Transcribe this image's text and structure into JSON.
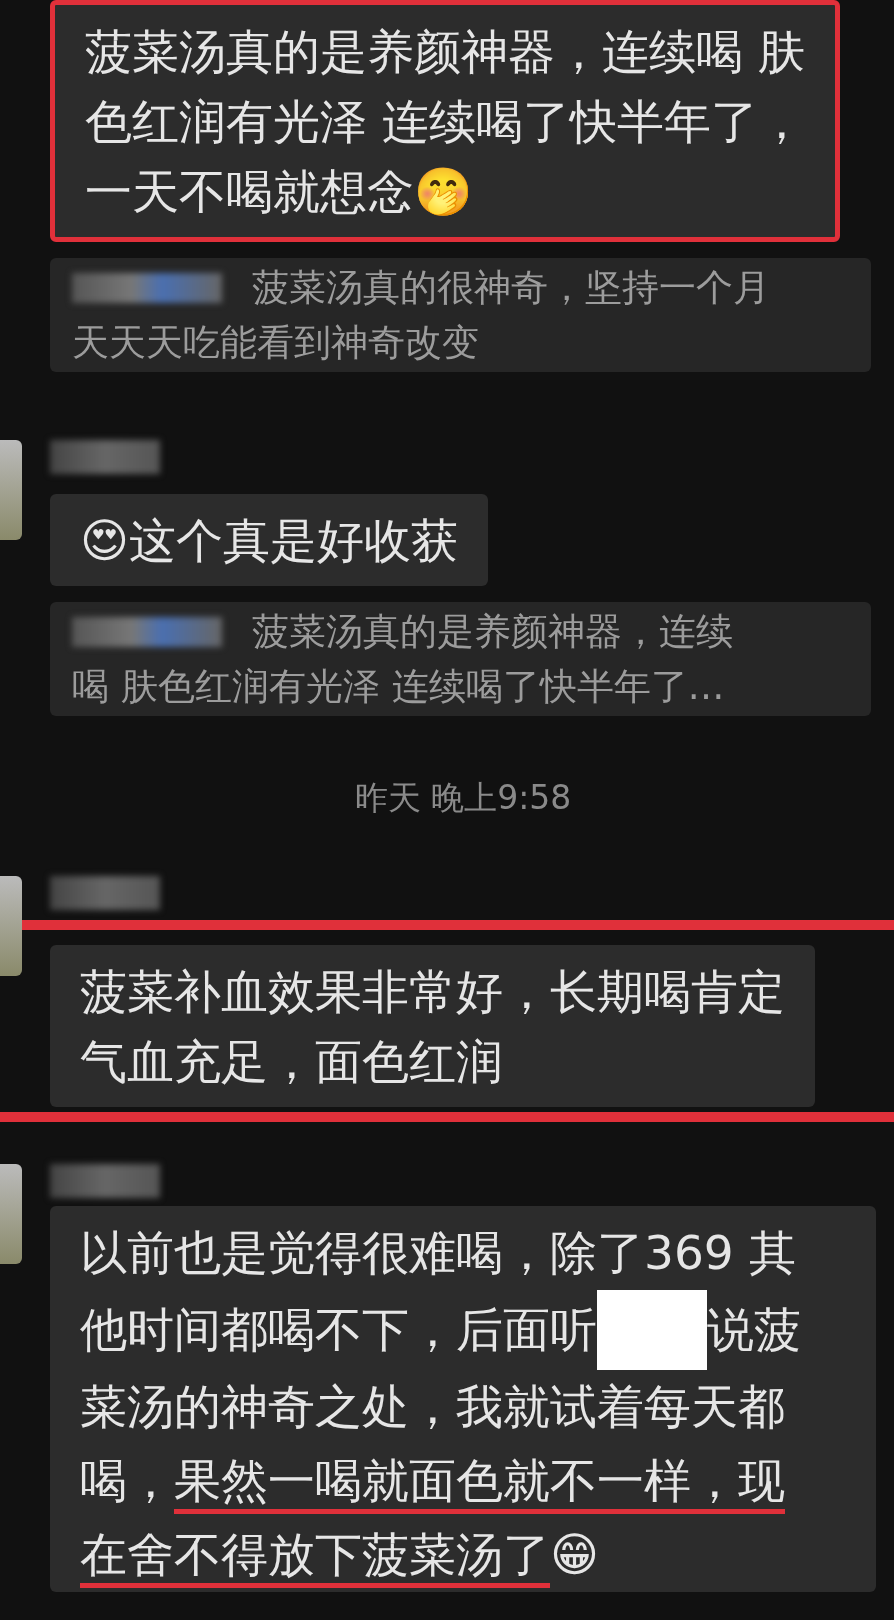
{
  "messages": [
    {
      "kind": "bubble",
      "boxed": true,
      "ruled": false,
      "lines": [
        [
          {
            "kind": "text",
            "text": "菠菜汤真的是养颜神器，连续喝 肤"
          }
        ],
        [
          {
            "kind": "text",
            "text": "色红润有光泽 连续喝了快半年了，"
          }
        ],
        [
          {
            "kind": "text",
            "text": "一天不喝就想念🤭"
          }
        ]
      ]
    },
    {
      "kind": "quote",
      "lines": [
        "菠菜汤真的很神奇，坚持一个月",
        "天天天吃能看到神奇改变"
      ]
    },
    {
      "kind": "sender"
    },
    {
      "kind": "bubble",
      "boxed": false,
      "ruled": false,
      "lines": [
        [
          {
            "kind": "text",
            "text": "😍这个真是好收获"
          }
        ]
      ]
    },
    {
      "kind": "quote",
      "lines": [
        "菠菜汤真的是养颜神器，连续",
        "喝 肤色红润有光泽 连续喝了快半年了…"
      ]
    },
    {
      "kind": "time",
      "text": "昨天 晚上9:58"
    },
    {
      "kind": "sender"
    },
    {
      "kind": "bubble",
      "boxed": false,
      "ruled": true,
      "lines": [
        [
          {
            "kind": "text",
            "text": "菠菜补血效果非常好，长期喝肯定"
          }
        ],
        [
          {
            "kind": "text",
            "text": "气血充足，面色红润"
          }
        ]
      ]
    },
    {
      "kind": "sender"
    },
    {
      "kind": "bubble",
      "boxed": false,
      "ruled": false,
      "lines": [
        [
          {
            "kind": "text",
            "text": "以前也是觉得很难喝，除了369 其"
          }
        ],
        [
          {
            "kind": "text",
            "text": "他时间都喝不下，后面听"
          },
          {
            "kind": "redacted"
          },
          {
            "kind": "text",
            "text": "说菠"
          }
        ],
        [
          {
            "kind": "text",
            "text": "菜汤的神奇之处，我就试着每天都"
          }
        ],
        [
          {
            "kind": "text",
            "text": "喝，"
          },
          {
            "kind": "underlined",
            "text": "果然一喝就面色就不一样，现"
          }
        ],
        [
          {
            "kind": "underlined",
            "text": "在舍不得放下菠菜汤了"
          },
          {
            "kind": "text",
            "text": "😁"
          }
        ]
      ]
    }
  ]
}
